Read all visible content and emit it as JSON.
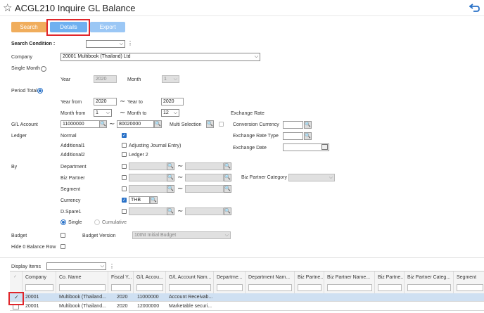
{
  "page_title": "ACGL210 Inquire GL Balance",
  "toolbar": {
    "search": "Search",
    "details": "Details",
    "export": "Export"
  },
  "search_condition": {
    "label": "Search Condition :"
  },
  "company": {
    "label": "Company",
    "value": "20001 Multibook (Thailand) Ltd"
  },
  "single_month": {
    "label": "Single Month",
    "year_label": "Year",
    "year_value": "2020",
    "month_label": "Month",
    "month_value": "1"
  },
  "period_total": {
    "label": "Period Total",
    "year_from_label": "Year from",
    "year_from": "2020",
    "year_to_label": "Year to",
    "year_to": "2020",
    "month_from_label": "Month from",
    "month_from": "1",
    "month_to_label": "Month to",
    "month_to": "12"
  },
  "gl_account": {
    "label": "G/L Account",
    "from": "11000000",
    "to": "80020000",
    "multi_label": "Multi Selection"
  },
  "exchange": {
    "label": "Exchange Rate",
    "conversion_currency": "Conversion Currency",
    "exchange_rate_type": "Exchange Rate Type",
    "exchange_date": "Exchange Date"
  },
  "ledger": {
    "label": "Ledger",
    "normal": "Normal",
    "additional1": "Additional1",
    "adjusting": "Adjusting Journal Entry)",
    "additional2": "Additional2",
    "ledger2": "Ledger 2"
  },
  "by": {
    "label": "By",
    "department": "Department",
    "biz_partner": "Biz Partner",
    "segment": "Segment",
    "currency": "Currency",
    "currency_value": "THB",
    "dspare": "D.Spare1",
    "single": "Single",
    "cumulative": "Cumulative",
    "biz_partner_category": "Biz Partner Category"
  },
  "budget": {
    "label": "Budget",
    "version_label": "Budget Version",
    "version_value": "10INI Initial Budget"
  },
  "hide_zero": {
    "label": "Hide 0 Balance Row"
  },
  "display_items": {
    "label": "Display Items"
  },
  "grid": {
    "columns": [
      "Company",
      "Co. Name",
      "Fiscal Y...",
      "G/L Accou...",
      "G/L Account Nam...",
      "Departme...",
      "Department Nam...",
      "Biz Partne...",
      "Biz Partner Name...",
      "Biz Partne...",
      "Biz Partner Categ...",
      "Segment"
    ],
    "rows": [
      {
        "company": "20001",
        "co_name": "Multibook (Thailand...",
        "fiscal": "2020",
        "gl": "11000000",
        "gl_name": "Account Receivab..."
      },
      {
        "company": "20001",
        "co_name": "Multibook (Thailand...",
        "fiscal": "2020",
        "gl": "12000000",
        "gl_name": "Marketable securi..."
      }
    ]
  },
  "colors": {
    "accent": "#2a72c8",
    "search_btn": "#f0ad5c",
    "details_btn": "#6fb0f0",
    "highlight": "#e0262b"
  }
}
